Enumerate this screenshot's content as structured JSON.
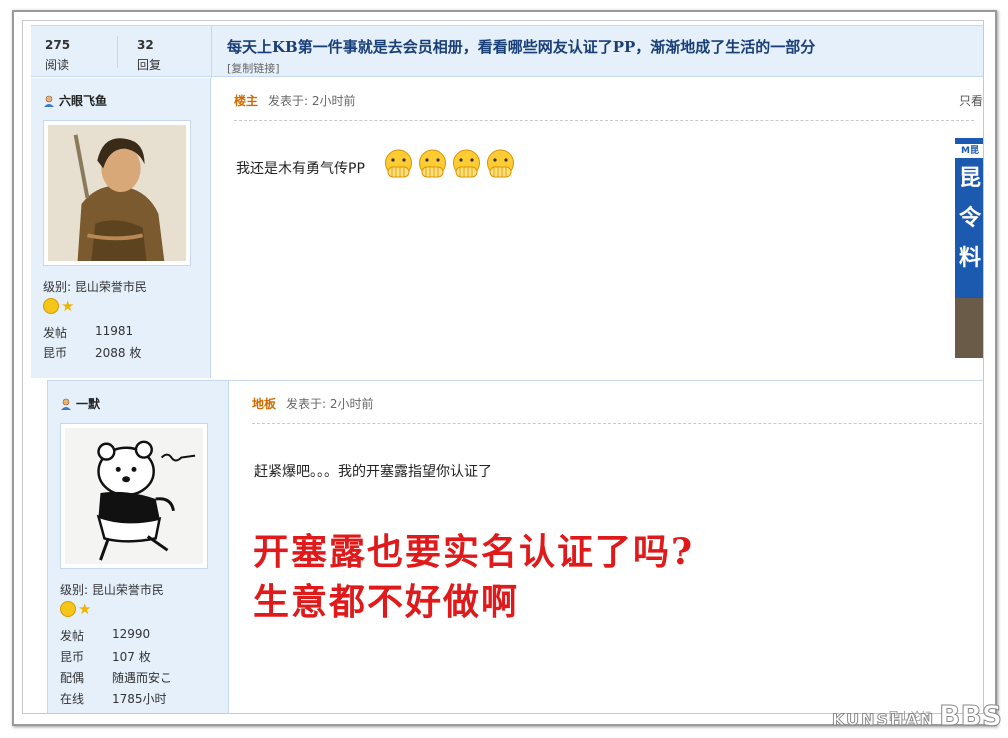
{
  "thread": {
    "views": "275",
    "views_label": "阅读",
    "replies": "32",
    "replies_label": "回复",
    "title": "每天上KB第一件事就是去会员相册，看看哪些网友认证了PP，渐渐地成了生活的一部分",
    "copy_link": "[复制链接]"
  },
  "post1": {
    "username": "六眼飞鱼",
    "level": "级别: 昆山荣誉市民",
    "stats": [
      {
        "key": "发帖",
        "value": "11981"
      },
      {
        "key": "昆币",
        "value": "2088 枚"
      }
    ],
    "floor": "楼主",
    "posted": "发表于: 2小时前",
    "only_view": "只看",
    "text": "我还是木有勇气传PP",
    "ad_tag": "M昆",
    "ad_chars": [
      "昆",
      "令",
      "料"
    ]
  },
  "post2": {
    "username": "一默",
    "level": "级别: 昆山荣誉市民",
    "stats": [
      {
        "key": "发帖",
        "value": "12990"
      },
      {
        "key": "昆币",
        "value": "107 枚"
      },
      {
        "key": "配偶",
        "value": "随遇而安こ"
      },
      {
        "key": "在线",
        "value": "1785小时"
      }
    ],
    "floor": "地板",
    "posted": "发表于: 2小时前",
    "text": "赶紧爆吧。。。我的开塞露指望你认证了"
  },
  "annotation": {
    "line1": "开塞露也要实名认证了吗?",
    "line2": "生意都不好做啊",
    "color": "#e01a1a"
  },
  "watermark": {
    "small": "昆山论坛",
    "big": "KUNSHAN",
    "bbs": "BBS"
  }
}
